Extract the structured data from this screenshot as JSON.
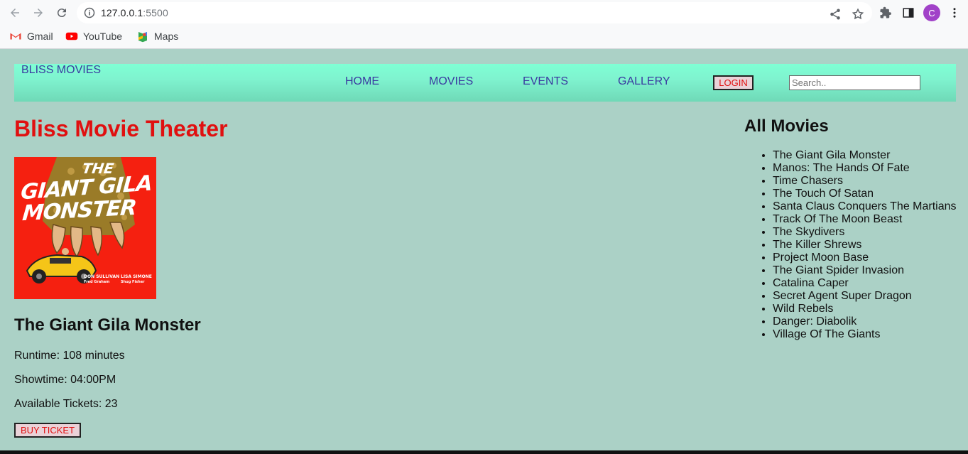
{
  "browser": {
    "url_host": "127.0.0.1",
    "url_port": ":5500",
    "avatar_letter": "C",
    "bookmarks": [
      {
        "label": "Gmail",
        "icon": "gmail-icon"
      },
      {
        "label": "YouTube",
        "icon": "youtube-icon"
      },
      {
        "label": "Maps",
        "icon": "maps-icon"
      }
    ]
  },
  "navbar": {
    "brand": "BLISS MOVIES",
    "links": [
      "HOME",
      "MOVIES",
      "EVENTS",
      "GALLERY"
    ],
    "login_label": "LOGIN",
    "search_placeholder": "Search.."
  },
  "main": {
    "title": "Bliss Movie Theater",
    "poster": {
      "line1": "THE",
      "line2": "GIANT GILA",
      "line3": "MONSTER",
      "credits_left_1": "DON SULLIVAN",
      "credits_left_2": "Fred Graham",
      "credits_right_1": "LISA SIMONE",
      "credits_right_2": "Shug Fisher"
    },
    "movie_title": "The Giant Gila Monster",
    "runtime": "Runtime: 108 minutes",
    "showtime": "Showtime: 04:00PM",
    "tickets": "Available Tickets: 23",
    "buy_label": "BUY TICKET"
  },
  "sidebar": {
    "title": "All Movies",
    "movies": [
      "The Giant Gila Monster",
      "Manos: The Hands Of Fate",
      "Time Chasers",
      "The Touch Of Satan",
      "Santa Claus Conquers The Martians",
      "Track Of The Moon Beast",
      "The Skydivers",
      "The Killer Shrews",
      "Project Moon Base",
      "The Giant Spider Invasion",
      "Catalina Caper",
      "Secret Agent Super Dragon",
      "Wild Rebels",
      "Danger: Diabolik",
      "Village Of The Giants"
    ]
  },
  "colors": {
    "page_bg": "#abd1c6",
    "navbar": "#7fffd4",
    "accent_red": "#e01010",
    "link_blue": "#3a3aa0"
  }
}
